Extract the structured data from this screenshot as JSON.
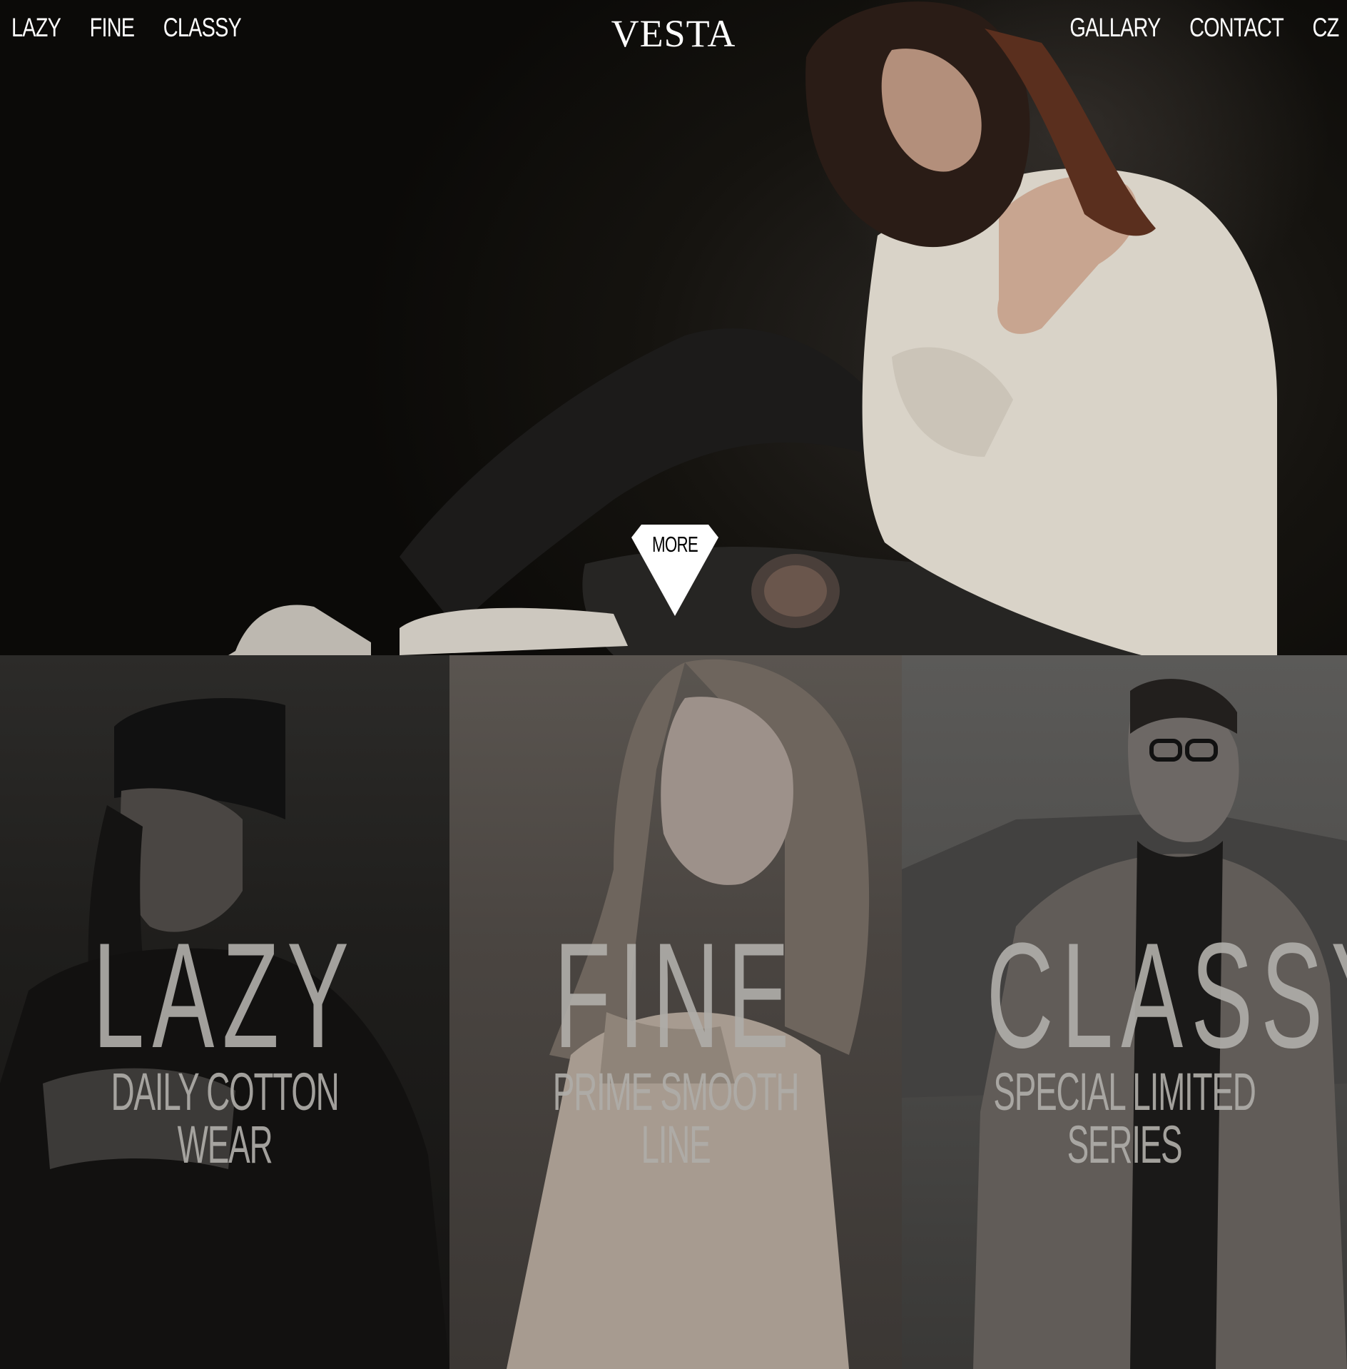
{
  "brand": {
    "logo_text": "VESTA"
  },
  "nav": {
    "left": [
      {
        "label": "LAZY"
      },
      {
        "label": "FINE"
      },
      {
        "label": "CLASSY"
      }
    ],
    "right": [
      {
        "label": "GALLARY"
      },
      {
        "label": "CONTACT"
      },
      {
        "label": "CZ"
      }
    ]
  },
  "hero": {
    "more_label": "MORE"
  },
  "categories": [
    {
      "title": "LAZY",
      "subtitle": "DAILY COTTON WEAR"
    },
    {
      "title": "FINE",
      "subtitle": "PRIME SMOOTH LINE"
    },
    {
      "title": "CLASSY",
      "subtitle": "SPECIAL LIMITED SERIES"
    }
  ],
  "colors": {
    "text": "#ffffff",
    "overlay_text": "#afaca8",
    "background": "#000000"
  },
  "icons": {
    "more": "diamond-down-icon"
  }
}
